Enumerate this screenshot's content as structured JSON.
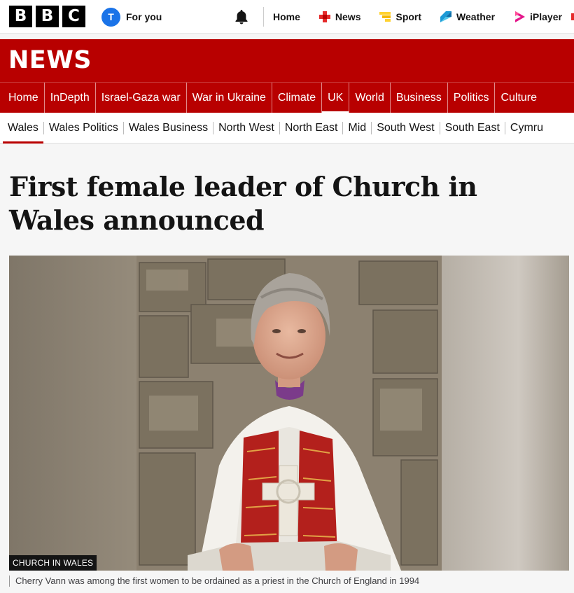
{
  "brand": {
    "letters": [
      "B",
      "B",
      "C"
    ]
  },
  "account": {
    "avatar_letter": "T",
    "label": "For you"
  },
  "topnav": [
    {
      "label": "Home",
      "icon": ""
    },
    {
      "label": "News",
      "icon": "news-icon"
    },
    {
      "label": "Sport",
      "icon": "sport-icon"
    },
    {
      "label": "Weather",
      "icon": "weather-icon"
    },
    {
      "label": "iPlayer",
      "icon": "iplayer-icon"
    }
  ],
  "masthead": {
    "title": "NEWS"
  },
  "section_nav": [
    "Home",
    "InDepth",
    "Israel-Gaza war",
    "War in Ukraine",
    "Climate",
    "UK",
    "World",
    "Business",
    "Politics",
    "Culture"
  ],
  "section_nav_active": "UK",
  "sub_nav": [
    "Wales",
    "Wales Politics",
    "Wales Business",
    "North West",
    "North East",
    "Mid",
    "South West",
    "South East",
    "Cymru"
  ],
  "sub_nav_active": "Wales",
  "article": {
    "headline": "First female leader of Church in Wales announced",
    "image_credit": "CHURCH IN WALES",
    "caption": "Cherry Vann was among the first women to be ordained as a priest in the Church of England in 1994"
  },
  "colors": {
    "brand_red": "#b80000",
    "accent_blue": "#1a73e8"
  }
}
